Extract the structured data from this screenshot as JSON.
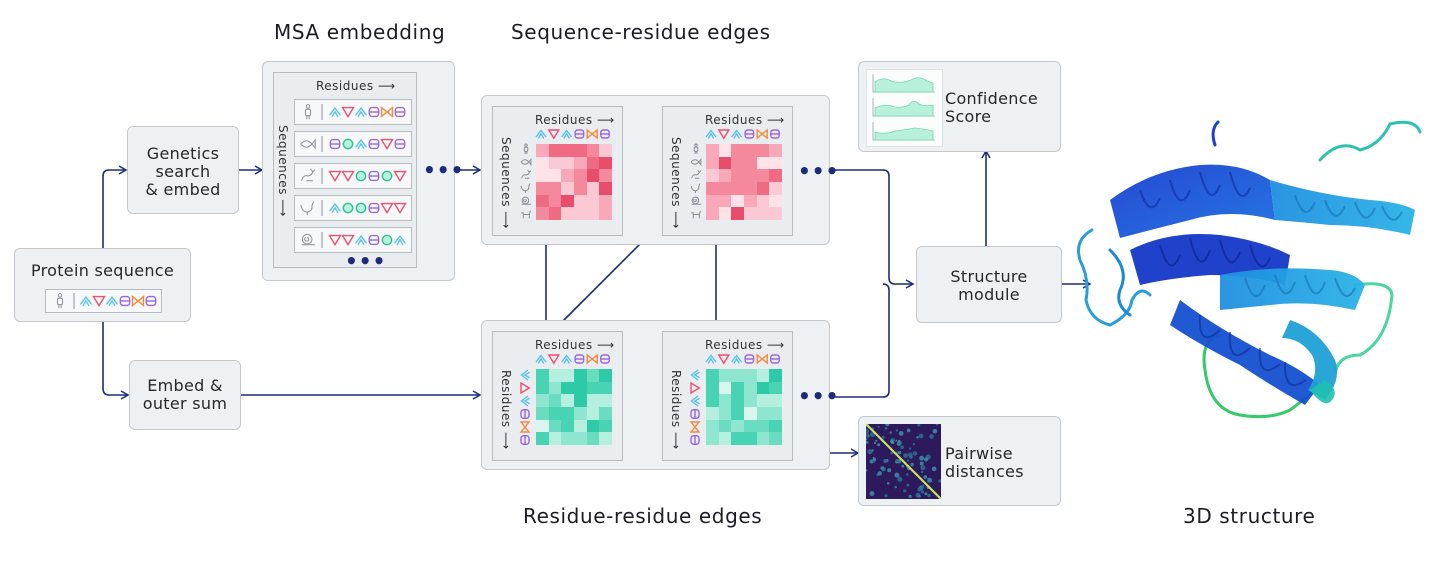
{
  "section_titles": {
    "msa": "MSA embedding",
    "seq_residue": "Sequence-residue edges",
    "residue_residue": "Residue-residue edges",
    "structure_3d": "3D structure"
  },
  "nodes": {
    "protein_sequence": "Protein sequence",
    "genetics_line1": "Genetics",
    "genetics_line2": "search",
    "genetics_line3": "& embed",
    "embed_line1": "Embed &",
    "embed_line2": "outer sum",
    "structure_line1": "Structure",
    "structure_line2": "module",
    "confidence_line1": "Confidence",
    "confidence_line2": "Score",
    "pairwise_line1": "Pairwise",
    "pairwise_line2": "distances"
  },
  "axis_labels": {
    "residues": "Residues ⟶",
    "sequences": "Sequences ⟶",
    "residues_vertical": "Residues ⟶"
  },
  "ellipsis": "•••",
  "residue_symbols": [
    "chevron-cyan",
    "triangle-red",
    "chevron-cyan",
    "box-purple",
    "bowtie-orange",
    "box-purple"
  ],
  "msa_rows": [
    {
      "organism": "human-icon",
      "residues": [
        "chevron",
        "triangle",
        "chevron",
        "box",
        "bowtie",
        "box"
      ]
    },
    {
      "organism": "fish-icon",
      "residues": [
        "box",
        "circle",
        "chevron",
        "box",
        "triangle",
        "box"
      ]
    },
    {
      "organism": "rabbit-icon",
      "residues": [
        "triangle",
        "triangle",
        "circle",
        "box",
        "circle",
        "triangle"
      ]
    },
    {
      "organism": "rooster-icon",
      "residues": [
        "chevron",
        "circle",
        "circle",
        "box",
        "triangle",
        "triangle"
      ]
    },
    {
      "organism": "snail-icon",
      "residues": [
        "triangle",
        "triangle",
        "chevron",
        "box",
        "circle",
        "chevron"
      ]
    }
  ],
  "colors": {
    "arrow": "#1e2b7a",
    "pink_scale": [
      "#fde3e8",
      "#fbc9d3",
      "#f8a8b8",
      "#f4889c",
      "#ef6a83",
      "#e84d6c"
    ],
    "teal_scale": [
      "#d9f7ef",
      "#b5efe0",
      "#8fe6d0",
      "#6adcc0",
      "#48d3b2",
      "#2ec9a6"
    ],
    "chevron": "#59c3e8",
    "triangle": "#ee4f6e",
    "box": "#9a66e0",
    "bowtie": "#f28a3a",
    "circle": "#3fd6a8"
  },
  "heatmaps": {
    "seq_res_1": [
      [
        2,
        4,
        4,
        4,
        3,
        1
      ],
      [
        0,
        1,
        1,
        2,
        4,
        5
      ],
      [
        0,
        0,
        2,
        3,
        5,
        3
      ],
      [
        3,
        3,
        1,
        3,
        1,
        5
      ],
      [
        4,
        3,
        5,
        1,
        1,
        2
      ],
      [
        3,
        4,
        1,
        1,
        1,
        2
      ]
    ],
    "seq_res_2": [
      [
        2,
        0,
        3,
        3,
        3,
        2
      ],
      [
        2,
        5,
        3,
        3,
        0,
        0
      ],
      [
        1,
        2,
        3,
        3,
        3,
        4
      ],
      [
        3,
        3,
        3,
        3,
        4,
        1
      ],
      [
        2,
        2,
        0,
        2,
        1,
        0
      ],
      [
        2,
        0,
        5,
        1,
        1,
        1
      ]
    ],
    "res_res_1": [
      [
        4,
        1,
        1,
        5,
        3,
        5
      ],
      [
        4,
        2,
        5,
        5,
        4,
        4
      ],
      [
        2,
        3,
        1,
        5,
        1,
        1
      ],
      [
        3,
        4,
        4,
        2,
        1,
        3
      ],
      [
        0,
        3,
        4,
        1,
        5,
        4
      ],
      [
        4,
        1,
        2,
        2,
        3,
        1
      ]
    ],
    "res_res_2": [
      [
        4,
        2,
        2,
        2,
        1,
        5
      ],
      [
        4,
        0,
        4,
        2,
        5,
        4
      ],
      [
        4,
        2,
        4,
        2,
        1,
        1
      ],
      [
        1,
        2,
        4,
        0,
        2,
        2
      ],
      [
        2,
        3,
        2,
        3,
        3,
        4
      ],
      [
        2,
        1,
        4,
        4,
        2,
        3
      ]
    ]
  }
}
